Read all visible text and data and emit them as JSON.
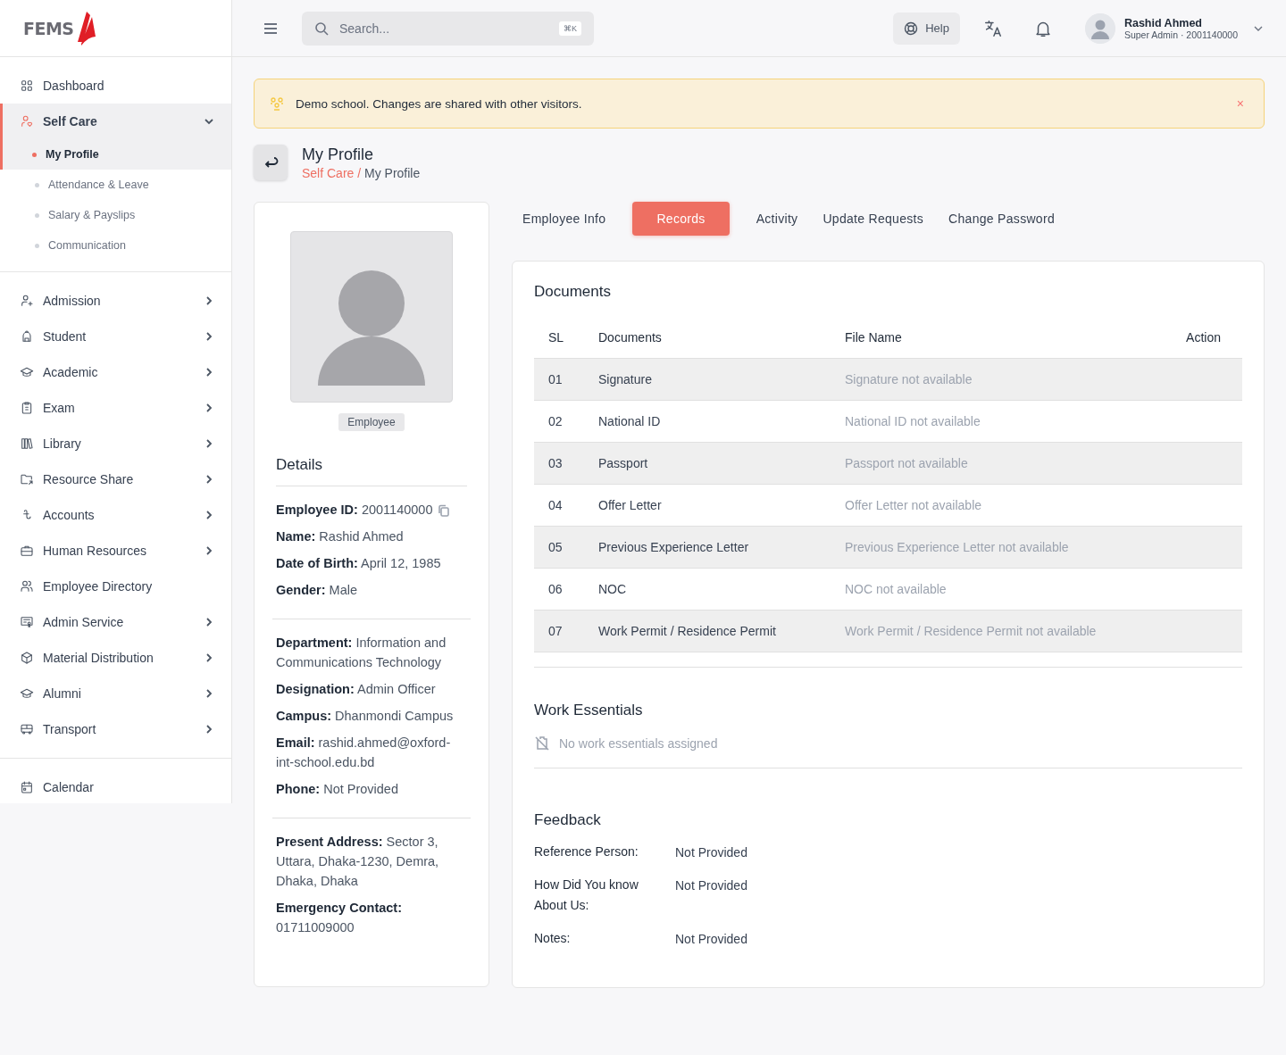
{
  "logo": {
    "text": "FEMS"
  },
  "sidebar": {
    "items": [
      {
        "label": "Dashboard",
        "selected": false
      },
      {
        "label": "Self Care",
        "expanded": true,
        "selected": true,
        "children": [
          {
            "label": "My Profile",
            "selected": true
          },
          {
            "label": "Attendance & Leave",
            "selected": false
          },
          {
            "label": "Salary & Payslips",
            "selected": false
          },
          {
            "label": "Communication",
            "selected": false
          }
        ]
      }
    ],
    "groups": [
      [
        {
          "label": "Admission",
          "expanded": false,
          "selected": false
        },
        {
          "label": "Student",
          "expanded": false,
          "selected": false
        },
        {
          "label": "Academic",
          "expanded": false,
          "selected": false
        },
        {
          "label": "Exam",
          "expanded": false,
          "selected": false
        },
        {
          "label": "Library",
          "expanded": false,
          "selected": false
        },
        {
          "label": "Resource Share",
          "expanded": false,
          "selected": false
        },
        {
          "label": "Accounts",
          "expanded": false,
          "selected": false
        },
        {
          "label": "Human Resources",
          "expanded": false,
          "selected": false
        },
        {
          "label": "Employee Directory",
          "selected": false
        },
        {
          "label": "Admin Service",
          "expanded": false,
          "selected": false
        },
        {
          "label": "Material Distribution",
          "expanded": false,
          "selected": false
        },
        {
          "label": "Alumni",
          "expanded": false,
          "selected": false
        },
        {
          "label": "Transport",
          "expanded": false,
          "selected": false
        }
      ],
      [
        {
          "label": "Calendar",
          "selected": false
        }
      ]
    ]
  },
  "topbar": {
    "search": {
      "placeholder": "Search...",
      "shortcut": "⌘K"
    },
    "help": "Help",
    "user": {
      "name": "Rashid Ahmed",
      "role": "Super Admin · 2001140000"
    }
  },
  "banner": {
    "text": "Demo school. Changes are shared with other visitors.",
    "close": "×"
  },
  "header": {
    "title": "My Profile",
    "separator": "/",
    "breadcrumb": [
      {
        "label": "Self Care",
        "link": true
      },
      {
        "label": "My Profile",
        "link": false
      }
    ]
  },
  "profile": {
    "role": "Employee",
    "details_title": "Details",
    "groups": [
      [
        {
          "text": "**Employee ID:** 2001140000",
          "copy": true
        },
        {
          "text": "**Name:** Rashid Ahmed"
        },
        {
          "text": "**Date of Birth:** April 12, 1985"
        },
        {
          "text": "**Gender:** Male"
        }
      ],
      [
        {
          "text": "**Department:** Information and Communications Technology"
        },
        {
          "text": "**Designation:** Admin Officer"
        },
        {
          "text": "**Campus:** Dhanmondi Campus"
        },
        {
          "text": "**Email:** rashid.ahmed@oxford-int-school.edu.bd"
        },
        {
          "text": "**Phone:** Not Provided"
        }
      ],
      [
        {
          "text": "**Present Address:** Sector 3, Uttara, Dhaka-1230, Demra, Dhaka, Dhaka"
        },
        {
          "text": "**Emergency Contact:** 01711009000"
        }
      ]
    ]
  },
  "tabs": [
    {
      "label": "Employee Info",
      "selected": false
    },
    {
      "label": "Records",
      "selected": true
    },
    {
      "label": "Activity",
      "selected": false
    },
    {
      "label": "Update Requests",
      "selected": false
    },
    {
      "label": "Change Password",
      "selected": false
    }
  ],
  "documents": {
    "title": "Documents",
    "columns": [
      "SL",
      "Documents",
      "File Name",
      "Action"
    ],
    "rows": [
      {
        "sl": "01",
        "document": "Signature",
        "file": "Signature not available"
      },
      {
        "sl": "02",
        "document": "National ID",
        "file": "National ID not available"
      },
      {
        "sl": "03",
        "document": "Passport",
        "file": "Passport not available"
      },
      {
        "sl": "04",
        "document": "Offer Letter",
        "file": "Offer Letter not available"
      },
      {
        "sl": "05",
        "document": "Previous Experience Letter",
        "file": "Previous Experience Letter not available"
      },
      {
        "sl": "06",
        "document": "NOC",
        "file": "NOC not available"
      },
      {
        "sl": "07",
        "document": "Work Permit / Residence Permit",
        "file": "Work Permit / Residence Permit not available"
      }
    ]
  },
  "work_essentials": {
    "title": "Work Essentials",
    "empty": "No work essentials assigned"
  },
  "feedback": {
    "title": "Feedback",
    "fields": [
      {
        "label": "Reference Person:",
        "value": "Not Provided"
      },
      {
        "label": "How Did You know About Us:",
        "value": "Not Provided"
      },
      {
        "label": "Notes:",
        "value": "Not Provided"
      }
    ]
  }
}
